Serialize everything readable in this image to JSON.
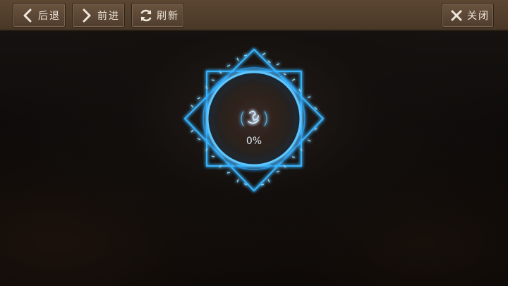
{
  "toolbar": {
    "back_label": "后退",
    "forward_label": "前进",
    "refresh_label": "刷新",
    "close_label": "关闭"
  },
  "loader": {
    "progress_text": "0%",
    "progress_value": 0,
    "glow_color": "#2fa9ff",
    "icons": [
      "rune-circle-icon",
      "flame-icon"
    ]
  }
}
